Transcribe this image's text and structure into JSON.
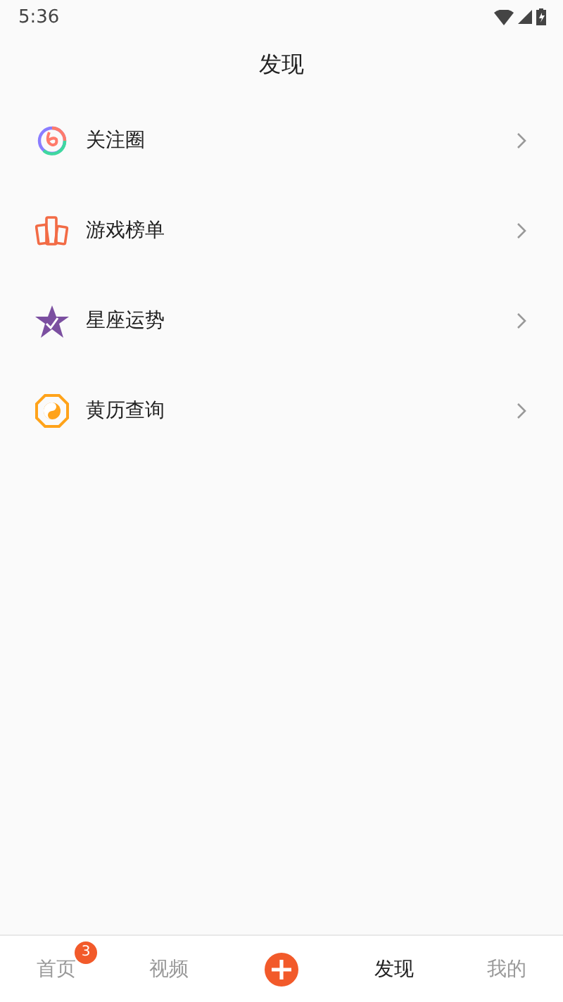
{
  "status_bar": {
    "time": "5:36"
  },
  "title": "发现",
  "items": [
    {
      "label": "关注圈",
      "kind": "ring"
    },
    {
      "label": "游戏榜单",
      "kind": "cards"
    },
    {
      "label": "星座运势",
      "kind": "star"
    },
    {
      "label": "黄历查询",
      "kind": "almanac"
    }
  ],
  "tab_bar": [
    {
      "label": "首页",
      "selected": false,
      "badge": "3"
    },
    {
      "label": "视频",
      "selected": false
    },
    {
      "kind": "add"
    },
    {
      "label": "发现",
      "selected": true
    },
    {
      "label": "我的",
      "selected": false
    }
  ]
}
